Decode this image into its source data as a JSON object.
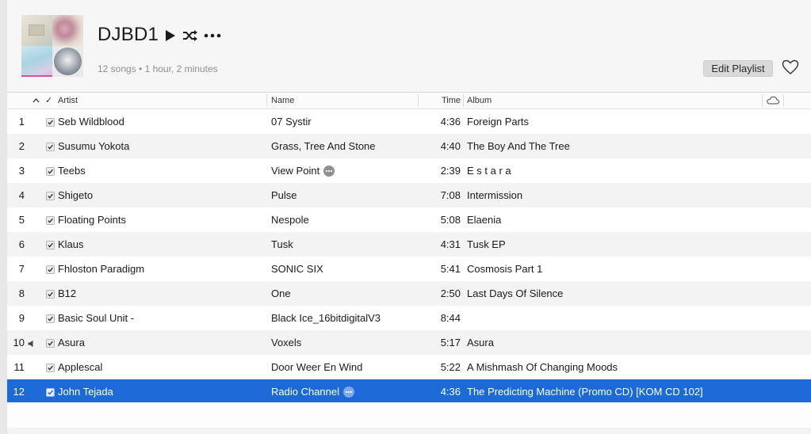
{
  "playlist": {
    "title": "DJBD1",
    "summary": "12 songs • 1 hour, 2 minutes",
    "edit_label": "Edit Playlist",
    "icons": [
      "play-icon",
      "shuffle-icon",
      "more-icon",
      "heart-icon"
    ]
  },
  "columns": {
    "sort_indicator": "^",
    "check": "✓",
    "artist": "Artist",
    "name": "Name",
    "time": "Time",
    "album": "Album",
    "cloud_icon": "cloud-icon"
  },
  "colors": {
    "selection": "#1b6ad6",
    "row_alt": "#f3f3f3"
  },
  "tracks": [
    {
      "num": "1",
      "artist": "Seb Wildblood",
      "name": "07 Systir",
      "time": "4:36",
      "album": "Foreign Parts",
      "has_more": false,
      "playing": false,
      "selected": false
    },
    {
      "num": "2",
      "artist": "Susumu Yokota",
      "name": "Grass, Tree And Stone",
      "time": "4:40",
      "album": "The Boy And The Tree",
      "has_more": false,
      "playing": false,
      "selected": false
    },
    {
      "num": "3",
      "artist": "Teebs",
      "name": "View Point",
      "time": "2:39",
      "album": "E s t a r a",
      "has_more": true,
      "playing": false,
      "selected": false
    },
    {
      "num": "4",
      "artist": "Shigeto",
      "name": "Pulse",
      "time": "7:08",
      "album": "Intermission",
      "has_more": false,
      "playing": false,
      "selected": false
    },
    {
      "num": "5",
      "artist": "Floating Points",
      "name": "Nespole",
      "time": "5:08",
      "album": "Elaenia",
      "has_more": false,
      "playing": false,
      "selected": false
    },
    {
      "num": "6",
      "artist": "Klaus",
      "name": "Tusk",
      "time": "4:31",
      "album": "Tusk EP",
      "has_more": false,
      "playing": false,
      "selected": false
    },
    {
      "num": "7",
      "artist": "Fhloston Paradigm",
      "name": "SONIC SIX",
      "time": "5:41",
      "album": "Cosmosis Part 1",
      "has_more": false,
      "playing": false,
      "selected": false
    },
    {
      "num": "8",
      "artist": "B12",
      "name": "One",
      "time": "2:50",
      "album": "Last Days Of Silence",
      "has_more": false,
      "playing": false,
      "selected": false
    },
    {
      "num": "9",
      "artist": "Basic Soul Unit -",
      "name": "Black Ice_16bitdigitalV3",
      "time": "8:44",
      "album": "",
      "has_more": false,
      "playing": false,
      "selected": false
    },
    {
      "num": "10",
      "artist": "Asura",
      "name": "Voxels",
      "time": "5:17",
      "album": "Asura",
      "has_more": false,
      "playing": true,
      "selected": false
    },
    {
      "num": "11",
      "artist": "Applescal",
      "name": "Door Weer En Wind",
      "time": "5:22",
      "album": "A Mishmash Of Changing Moods",
      "has_more": false,
      "playing": false,
      "selected": false
    },
    {
      "num": "12",
      "artist": "John Tejada",
      "name": "Radio Channel",
      "time": "4:36",
      "album": "The Predicting Machine (Promo CD) [KOM CD 102]",
      "has_more": true,
      "playing": false,
      "selected": true
    }
  ]
}
